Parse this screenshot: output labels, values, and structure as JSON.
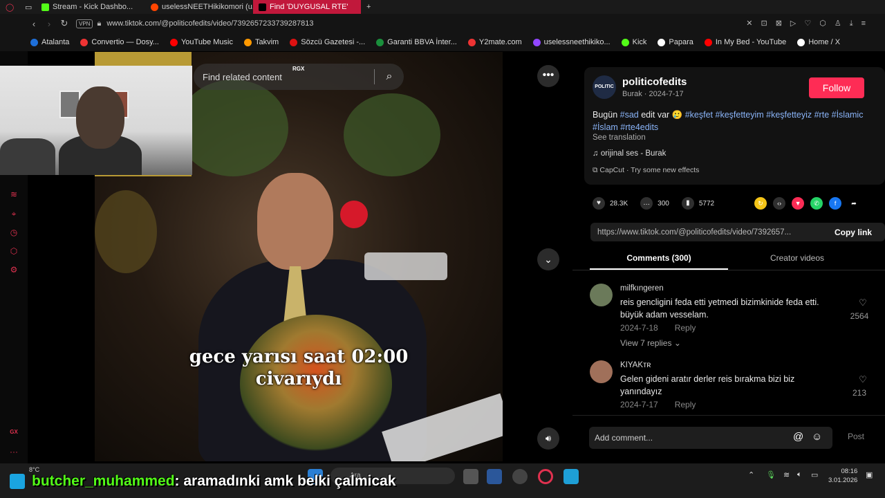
{
  "browser": {
    "tabs": [
      {
        "label": "Stream - Kick Dashbo...",
        "color": "#53fc18"
      },
      {
        "label": "uselessNEETHikikomori (u...",
        "color": "#ff4500"
      },
      {
        "label": "Find 'DUYGUSAL RTE'",
        "color": "#fe2c55"
      }
    ],
    "new_tab": "+",
    "vpn": "VPN",
    "url": "www.tiktok.com/@politicofedits/video/7392657233739287813",
    "bookmarks": [
      {
        "label": "Atalanta",
        "color": "#1e6fd9"
      },
      {
        "label": "Convertio — Dosy...",
        "color": "#e33"
      },
      {
        "label": "YouTube Music",
        "color": "#f00"
      },
      {
        "label": "Takvim",
        "color": "#f90"
      },
      {
        "label": "Sözcü Gazetesi -...",
        "color": "#d11"
      },
      {
        "label": "Garanti BBVA İnter...",
        "color": "#1a8f3c"
      },
      {
        "label": "Y2mate.com",
        "color": "#e33"
      },
      {
        "label": "uselessneethikiko...",
        "color": "#9146ff"
      },
      {
        "label": "Kick",
        "color": "#53fc18"
      },
      {
        "label": "Papara",
        "color": "#fff"
      },
      {
        "label": "In My Bed - YouTube",
        "color": "#f00"
      },
      {
        "label": "Home / X",
        "color": "#fff"
      }
    ]
  },
  "search": {
    "placeholder": "Find related content",
    "badge": "RGX"
  },
  "video": {
    "caption_line1": "gece yarısı saat 02:00",
    "caption_line2": "civarıydı"
  },
  "post": {
    "avatar_text": "POLITIC",
    "username": "politicofedits",
    "meta": "Burak · 2024-7-17",
    "follow": "Follow",
    "desc_prefix": "Bugün ",
    "desc_tag1": "#sad",
    "desc_mid": " edit var 🥲 ",
    "desc_tags_rest": "#keşfet #keşfetteyim #keşfetteyiz #rte #İslamic #İslam #rte4edits",
    "see_translation": "See translation",
    "sound": "orijinal ses - Burak",
    "capcut": "CapCut · Try some new effects",
    "likes": "28.3K",
    "comments_count": "300",
    "saves": "5772",
    "link": "https://www.tiktok.com/@politicofedits/video/7392657...",
    "copy_link": "Copy link"
  },
  "tabs": {
    "comments": "Comments (300)",
    "creator": "Creator videos"
  },
  "comments": [
    {
      "user": "milfkıngeren",
      "text": "reis gencligini feda etti yetmedi bizimkinide feda etti. büyük adam vesselam.",
      "date": "2024-7-18",
      "reply": "Reply",
      "likes": "2564",
      "view_replies": "View 7 replies ⌄"
    },
    {
      "user": "KIYAKᴛʀ",
      "text": "Gelen gideni aratır derler reis bırakma bizi biz yanındayız",
      "date": "2024-7-17",
      "reply": "Reply",
      "likes": "213"
    }
  ],
  "comment_box": {
    "placeholder": "Add comment...",
    "post": "Post"
  },
  "taskbar": {
    "weather": "8°C",
    "chat_user": "butcher_muhammed",
    "chat_message": " : aramadınki amk belki çalmicak",
    "search_label": "Ara",
    "time": "08:16",
    "date": "3.01.2026"
  }
}
